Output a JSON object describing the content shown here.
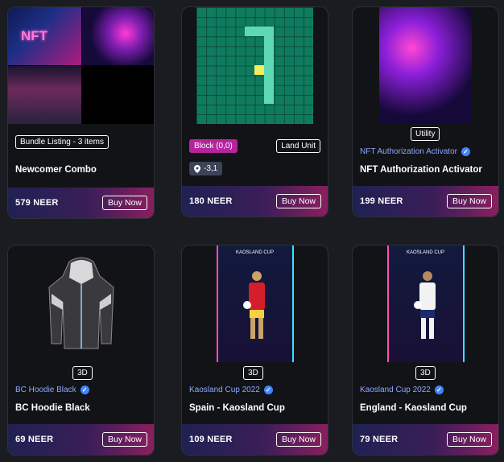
{
  "cards": [
    {
      "id": "c1",
      "title": "Newcomer Combo",
      "tag": "Bundle Listing - 3 items",
      "price": "579 NEER",
      "buy": "Buy Now",
      "thumb_text": "NFT"
    },
    {
      "id": "c2",
      "badge": "Block (0,0)",
      "tag": "Land Unit",
      "location": "-3,1",
      "price": "180 NEER",
      "buy": "Buy Now"
    },
    {
      "id": "c3",
      "tag": "Utility",
      "creator": "NFT Authorization Activator",
      "title": "NFT Authorization Activator",
      "price": "199 NEER",
      "buy": "Buy Now"
    },
    {
      "id": "c4",
      "tag": "3D",
      "creator": "BC Hoodie Black",
      "title": "BC Hoodie Black",
      "price": "69 NEER",
      "buy": "Buy Now"
    },
    {
      "id": "c5",
      "tag": "3D",
      "creator": "Kaosland Cup 2022",
      "title": "Spain - Kaosland Cup",
      "price": "109 NEER",
      "buy": "Buy Now",
      "thumb_text": "KAOSLAND CUP"
    },
    {
      "id": "c6",
      "tag": "3D",
      "creator": "Kaosland Cup 2022",
      "title": "England - Kaosland Cup",
      "price": "79 NEER",
      "buy": "Buy Now",
      "thumb_text": "KAOSLAND CUP"
    }
  ],
  "colors": {
    "background": "#1b1c21",
    "card": "#121317",
    "accent_pink": "#b5239d",
    "verified_blue": "#3f86ff",
    "creator_blue": "#8ea7ff",
    "land_green": "#0f7b5e"
  },
  "icons": {
    "verified": "check-badge-icon",
    "location": "map-pin-icon"
  }
}
